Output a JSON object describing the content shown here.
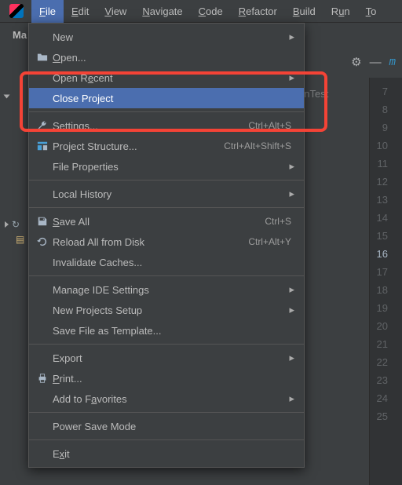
{
  "menubar": {
    "items": [
      {
        "label": "File",
        "accel": "F",
        "active": true
      },
      {
        "label": "Edit",
        "accel": "E"
      },
      {
        "label": "View",
        "accel": "V"
      },
      {
        "label": "Navigate",
        "accel": "N"
      },
      {
        "label": "Code",
        "accel": "C"
      },
      {
        "label": "Refactor",
        "accel": "R"
      },
      {
        "label": "Build",
        "accel": "B"
      },
      {
        "label": "Run",
        "accel": "u",
        "accel_pos": 1
      },
      {
        "label": "Tools",
        "accel": "T",
        "truncated": "To"
      }
    ]
  },
  "toolrow": {
    "title": "Ma"
  },
  "right_tab": {
    "gear": "⚙",
    "minus": "—",
    "m": "m"
  },
  "project_hint": "enTest",
  "menu": {
    "new": {
      "label": "New"
    },
    "open": {
      "label": "Open..."
    },
    "open_recent": {
      "label": "Open Recent"
    },
    "close_project": {
      "label": "Close Project"
    },
    "settings": {
      "label": "Settings...",
      "shortcut": "Ctrl+Alt+S"
    },
    "project_struct": {
      "label": "Project Structure...",
      "shortcut": "Ctrl+Alt+Shift+S"
    },
    "file_props": {
      "label": "File Properties"
    },
    "local_history": {
      "label": "Local History"
    },
    "save_all": {
      "label": "Save All",
      "shortcut": "Ctrl+S"
    },
    "reload": {
      "label": "Reload All from Disk",
      "shortcut": "Ctrl+Alt+Y"
    },
    "invalidate": {
      "label": "Invalidate Caches..."
    },
    "manage_ide": {
      "label": "Manage IDE Settings"
    },
    "new_projects": {
      "label": "New Projects Setup"
    },
    "save_template": {
      "label": "Save File as Template..."
    },
    "export": {
      "label": "Export"
    },
    "print": {
      "label": "Print..."
    },
    "favorites": {
      "label": "Add to Favorites"
    },
    "power_save": {
      "label": "Power Save Mode"
    },
    "exit": {
      "label": "Exit"
    }
  },
  "gutter": {
    "lines": [
      "7",
      "8",
      "9",
      "10",
      "11",
      "12",
      "13",
      "14",
      "15",
      "16",
      "17",
      "18",
      "19",
      "20",
      "21",
      "22",
      "23",
      "24",
      "25"
    ],
    "caret_line": "16"
  }
}
